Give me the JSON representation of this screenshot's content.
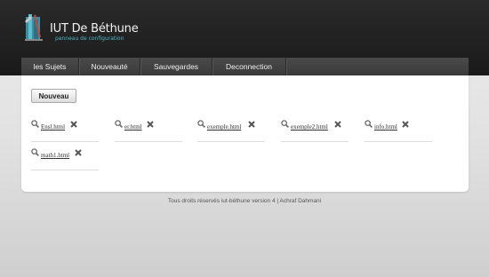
{
  "brand": {
    "title": "IUT De Béthune",
    "subtitle": "panneau de configuration"
  },
  "nav": [
    {
      "label": "les Sujets"
    },
    {
      "label": "Nouveauté"
    },
    {
      "label": "Sauvegardes"
    },
    {
      "label": "Deconnection"
    }
  ],
  "toolbar": {
    "new_label": "Nouveau"
  },
  "files": [
    {
      "name": "Ensl.html"
    },
    {
      "name": "er.html"
    },
    {
      "name": "exemple.html"
    },
    {
      "name": "exemple2.html"
    },
    {
      "name": "info.html"
    },
    {
      "name": "math1.html"
    }
  ],
  "footer": {
    "text": "Tous droits réservés iut-béthune version 4 | Achraf Dahmani"
  },
  "icons": {
    "search": "magnifier-icon",
    "delete": "x-icon"
  },
  "colors": {
    "header_bg": "#1f1f1f",
    "nav_bg": "#444444",
    "accent": "#4fb6c8",
    "panel_bg": "#ffffff"
  }
}
